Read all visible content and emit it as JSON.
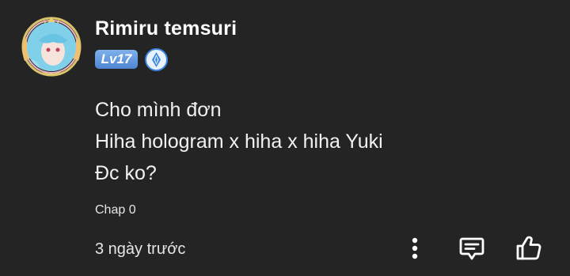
{
  "comment": {
    "username": "Rimiru temsuri",
    "level": "Lv17",
    "rank_icon": "blue-crystal-icon",
    "lines": [
      "Cho mình đơn",
      "Hiha hologram x hiha x hiha Yuki",
      "Đc ko?"
    ],
    "chapter": "Chap 0",
    "timestamp": "3 ngày trước",
    "actions": {
      "more": "more-vertical-icon",
      "reply": "reply-comment-icon",
      "like": "thumbs-up-icon"
    }
  },
  "colors": {
    "background": "#242424",
    "text": "#ffffff",
    "level_badge": "#5b93dd",
    "rank_icon": "#3a86e0"
  }
}
